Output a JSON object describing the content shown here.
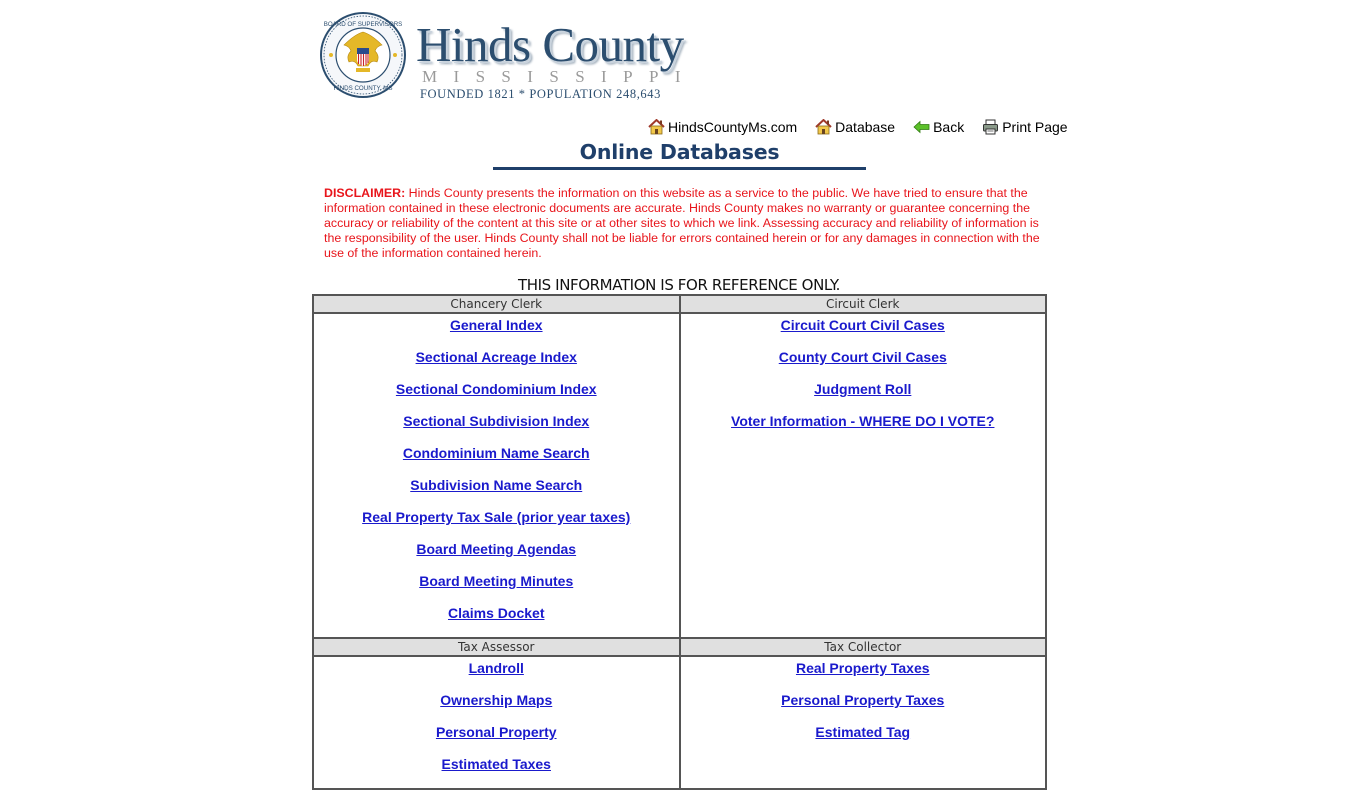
{
  "header": {
    "brand_name": "Hinds County",
    "brand_state": "MISSISSIPPI",
    "brand_founded": "FOUNDED 1821 * POPULATION 248,643",
    "seal_alt": "Board of Supervisors Hinds County, MS seal"
  },
  "nav": {
    "items": [
      {
        "label": "HindsCountyMs.com",
        "icon": "home-icon"
      },
      {
        "label": "Database",
        "icon": "home-icon"
      },
      {
        "label": "Back",
        "icon": "back-arrow-icon"
      },
      {
        "label": "Print Page",
        "icon": "printer-icon"
      }
    ]
  },
  "page_title": "Online Databases",
  "disclaimer": {
    "label": "DISCLAIMER:",
    "text": " Hinds County presents the information on this website as a service to the public. We have tried to ensure that the information contained in these electronic documents are accurate. Hinds County makes no warranty or guarantee concerning the accuracy or reliability of the content at this site or at other sites to which we link. Assessing accuracy and reliability of information is the responsibility of the user. Hinds County shall not be liable for errors contained herein or for any damages in connection with the use of the information contained herein."
  },
  "reference_notice": "THIS INFORMATION IS FOR REFERENCE ONLY.",
  "sections": {
    "chancery_clerk": {
      "title": "Chancery Clerk",
      "links": [
        "General Index",
        "Sectional Acreage Index",
        "Sectional Condominium Index",
        "Sectional Subdivision Index",
        "Condominium Name Search",
        "Subdivision Name Search",
        "Real Property Tax Sale (prior year taxes)",
        "Board Meeting Agendas",
        "Board Meeting Minutes",
        "Claims Docket"
      ]
    },
    "circuit_clerk": {
      "title": "Circuit Clerk",
      "links": [
        "Circuit Court Civil Cases",
        "County Court Civil Cases",
        "Judgment Roll",
        "Voter Information - WHERE DO I VOTE?"
      ]
    },
    "tax_assessor": {
      "title": "Tax Assessor",
      "links": [
        "Landroll",
        "Ownership Maps",
        "Personal Property",
        "Estimated Taxes"
      ]
    },
    "tax_collector": {
      "title": "Tax Collector",
      "links": [
        "Real Property Taxes",
        "Personal Property Taxes",
        "Estimated Tag"
      ]
    }
  },
  "colors": {
    "brand_blue": "#2c4e6f",
    "title_blue": "#1f3f6a",
    "disclaimer_red": "#e8151b",
    "link_blue": "#1a1acc",
    "header_gray": "#e0e0e0"
  }
}
